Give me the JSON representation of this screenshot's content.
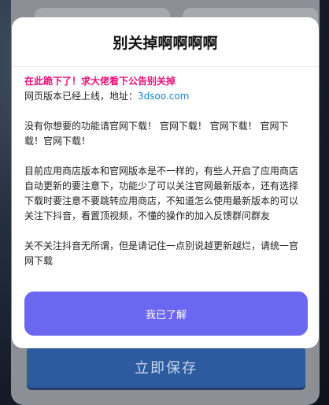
{
  "background": {
    "save_button_label": "立即保存"
  },
  "modal": {
    "title": "别关掉啊啊啊啊",
    "warning": "在此跪下了！求大佬看下公告别关掉",
    "web_version_prefix": "网页版本已经上线，地址：",
    "web_version_url": "3dsoo.com",
    "paragraph_1": "没有你想要的功能请官网下载！ 官网下载！ 官网下载！ 官网下载！官网下载！",
    "paragraph_2": "目前应用商店版本和官网版本是不一样的，有些人开启了应用商店自动更新的要注意下，功能少了可以关注官网最新版本，还有选择下载时要注意不要跳转应用商店，不知道怎么使用最新版本的可以关注下抖音，看置顶视频，不懂的操作的加入反馈群问群友",
    "paragraph_3": "关不关注抖音无所谓，但是请记住一点别说越更新越烂，请统一官网下载",
    "confirm_label": "我已了解"
  },
  "colors": {
    "accent": "#6c67f0",
    "warning": "#e8107a",
    "link": "#1a84d0",
    "save_button": "#2c5b9f"
  }
}
